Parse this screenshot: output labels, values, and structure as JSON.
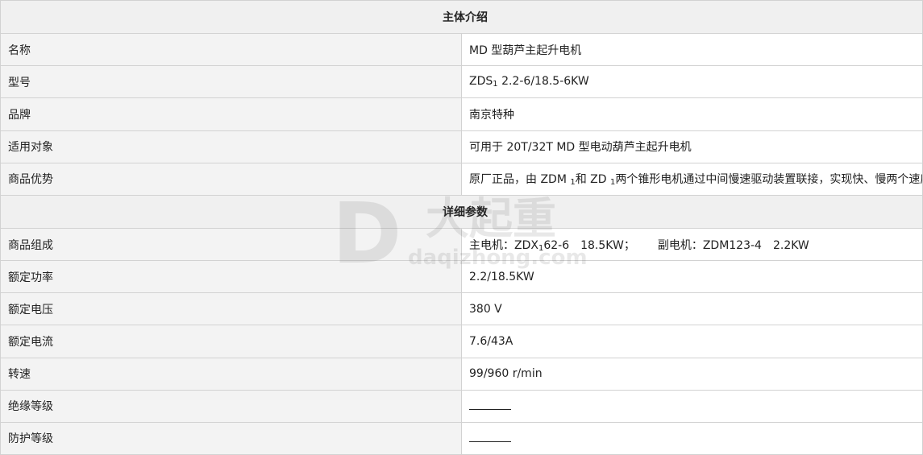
{
  "sections": {
    "intro_title": "主体介绍",
    "detail_title": "详细参数"
  },
  "intro": [
    {
      "label": "名称",
      "value": "MD 型葫芦主起升电机"
    },
    {
      "label": "型号",
      "value_parts": [
        "ZDS",
        "1",
        " 2.2-6/18.5-6KW"
      ]
    },
    {
      "label": "品牌",
      "value": "南京特种"
    },
    {
      "label": "适用对象",
      "value": "可用于 20T/32T MD 型电动葫芦主起升电机"
    },
    {
      "label": "商品优势",
      "value_parts": [
        "原厂正品，由 ZDM ",
        "1",
        "和 ZD ",
        "1",
        "两个锥形电机通过中间慢速驱动装置联接，实现快、慢两个速度。"
      ]
    }
  ],
  "detail": [
    {
      "label": "商品组成",
      "value_parts": [
        "主电机：ZDX",
        "1",
        "62-6　18.5KW；",
        "副电机：ZDM123-4　2.2KW"
      ]
    },
    {
      "label": "额定功率",
      "value": "2.2/18.5KW"
    },
    {
      "label": "额定电压",
      "value": "380 V"
    },
    {
      "label": "额定电流",
      "value": "7.6/43A"
    },
    {
      "label": "转速",
      "value": "99/960 r/min"
    },
    {
      "label": "绝缘等级",
      "value": ""
    },
    {
      "label": "防护等级",
      "value": ""
    }
  ],
  "watermark": {
    "brand": "大起重",
    "domain": "daqizhong.com",
    "logo_letter": "D"
  }
}
